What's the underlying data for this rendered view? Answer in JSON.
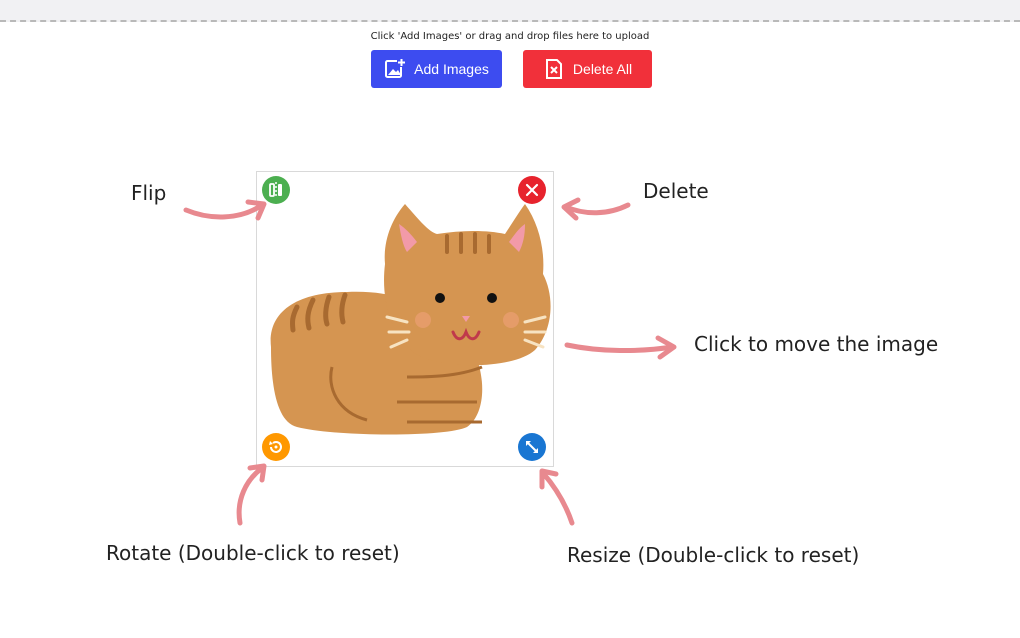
{
  "header": {
    "hint": "Click 'Add Images' or drag and drop files here to upload"
  },
  "toolbar": {
    "add_label": "Add Images",
    "delete_all_label": "Delete All",
    "add_color": "#3d4cf0",
    "delete_all_color": "#f1303a"
  },
  "image": {
    "subject": "cat illustration"
  },
  "controls": {
    "flip_icon": "flip-icon",
    "delete_icon": "close-icon",
    "rotate_icon": "rotate-icon",
    "resize_icon": "resize-icon",
    "flip_color": "#4caf50",
    "delete_color": "#e7232d",
    "rotate_color": "#ff9800",
    "resize_color": "#1976d2"
  },
  "annotations": {
    "flip": "Flip",
    "delete": "Delete",
    "move": "Click to move the image",
    "rotate": "Rotate (Double-click to reset)",
    "resize": "Resize (Double-click to reset)",
    "arrow_color": "#e8898f"
  }
}
